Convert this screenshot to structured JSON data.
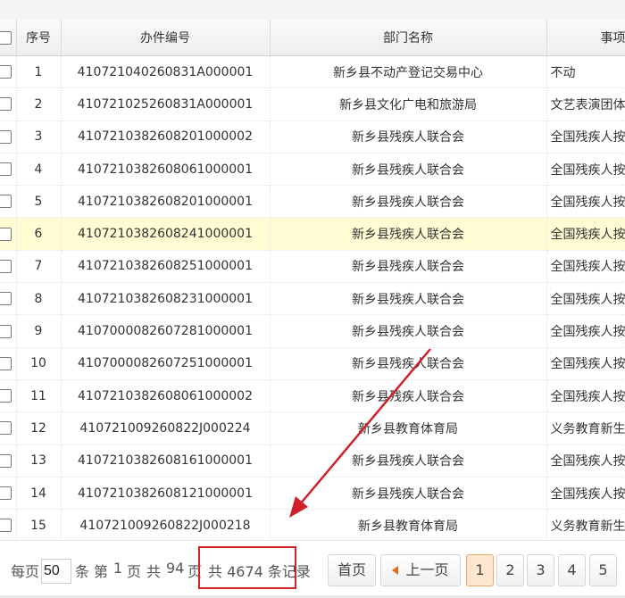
{
  "grid": {
    "headers": {
      "index": "序号",
      "case_number": "办件编号",
      "department": "部门名称",
      "item": "事项"
    },
    "rows": [
      {
        "index": "1",
        "case_number": "410721040260831A000001",
        "department": "新乡县不动产登记交易中心",
        "item": "不动"
      },
      {
        "index": "2",
        "case_number": "410721025260831A000001",
        "department": "新乡县文化广电和旅游局",
        "item": "文艺表演团体"
      },
      {
        "index": "3",
        "case_number": "410721038260820100000​2",
        "department": "新乡县残疾人联合会",
        "item": "全国残疾人按"
      },
      {
        "index": "4",
        "case_number": "410721038260806100000​1",
        "department": "新乡县残疾人联合会",
        "item": "全国残疾人按"
      },
      {
        "index": "5",
        "case_number": "410721038260820100000​1",
        "department": "新乡县残疾人联合会",
        "item": "全国残疾人按"
      },
      {
        "index": "6",
        "case_number": "410721038260824100000​1",
        "department": "新乡县残疾人联合会",
        "item": "全国残疾人按"
      },
      {
        "index": "7",
        "case_number": "410721038260825100000​1",
        "department": "新乡县残疾人联合会",
        "item": "全国残疾人按"
      },
      {
        "index": "8",
        "case_number": "410721038260823100000​1",
        "department": "新乡县残疾人联合会",
        "item": "全国残疾人按"
      },
      {
        "index": "9",
        "case_number": "410700008260728100000​1",
        "department": "新乡县残疾人联合会",
        "item": "全国残疾人按"
      },
      {
        "index": "10",
        "case_number": "410700008260725100000​1",
        "department": "新乡县残疾人联合会",
        "item": "全国残疾人按"
      },
      {
        "index": "11",
        "case_number": "410721038260806100000​2",
        "department": "新乡县残疾人联合会",
        "item": "全国残疾人按"
      },
      {
        "index": "12",
        "case_number": "410721009260822J000224",
        "department": "新乡县教育体育局",
        "item": "义务教育新生"
      },
      {
        "index": "13",
        "case_number": "410721038260816100000​1",
        "department": "新乡县残疾人联合会",
        "item": "全国残疾人按"
      },
      {
        "index": "14",
        "case_number": "410721038260812100000​1",
        "department": "新乡县残疾人联合会",
        "item": "全国残疾人按"
      },
      {
        "index": "15",
        "case_number": "410721009260822J000218",
        "department": "新乡县教育体育局",
        "item": "义务教育新生"
      }
    ],
    "highlighted_row": "6"
  },
  "pager": {
    "per_page_label": "每页",
    "page_size": "50",
    "items_label": "条",
    "page_prefix": "第",
    "current_page_text": "1",
    "page_unit": "页",
    "total_prefix": "共",
    "total_pages": "94",
    "records_summary": "共 4674 条记录",
    "first_label": "首页",
    "prev_label": "上一页",
    "pages": [
      "1",
      "2",
      "3",
      "4",
      "5"
    ],
    "active_page": "1"
  },
  "colors": {
    "highlight_row": "#fffcd4",
    "active_page_bg": "#fde8cf",
    "annotation_red": "#d0202a"
  }
}
